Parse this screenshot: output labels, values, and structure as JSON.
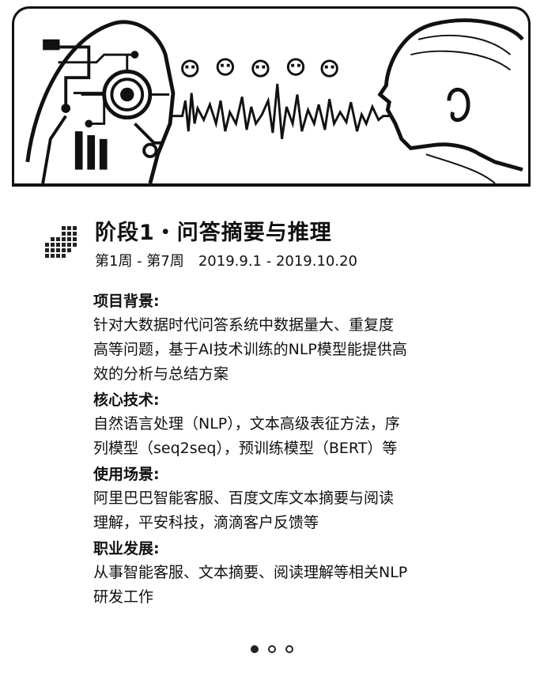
{
  "stage": {
    "title": "阶段1・问答摘要与推理",
    "weeks": "第1周 - 第7周",
    "dates": "2019.9.1 - 2019.10.20"
  },
  "sections": [
    {
      "heading": "项目背景:",
      "lines": [
        "针对大数据时代问答系统中数据量大、重复度",
        "高等问题，基于AI技术训练的NLP模型能提供高",
        "效的分析与总结方案"
      ]
    },
    {
      "heading": "核心技术:",
      "lines": [
        "自然语言处理（NLP），文本高级表征方法，序",
        "列模型（seq2seq），预训练模型（BERT）等"
      ]
    },
    {
      "heading": "使用场景:",
      "lines": [
        "阿里巴巴智能客服、百度文库文本摘要与阅读",
        "理解，平安科技，滴滴客户反馈等"
      ]
    },
    {
      "heading": "职业发展:",
      "lines": [
        "从事智能客服、文本摘要、阅读理解等相关NLP",
        "研发工作"
      ]
    }
  ],
  "pagination": {
    "total": 3,
    "active": 0
  },
  "icons": {
    "hero": "robot-human-dialogue-illustration",
    "stage": "pixel-grid-icon"
  }
}
